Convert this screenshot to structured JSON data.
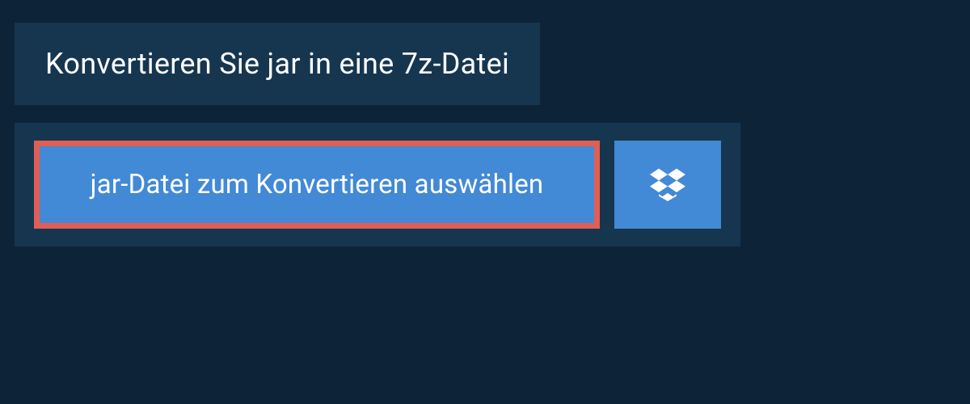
{
  "header": {
    "title": "Konvertieren Sie jar in eine 7z-Datei"
  },
  "upload": {
    "select_file_label": "jar-Datei zum Konvertieren auswählen"
  },
  "colors": {
    "page_bg": "#0d2438",
    "panel_bg": "#163650",
    "button_bg": "#4289d6",
    "highlight_border": "#e15e55",
    "text": "#ffffff"
  }
}
